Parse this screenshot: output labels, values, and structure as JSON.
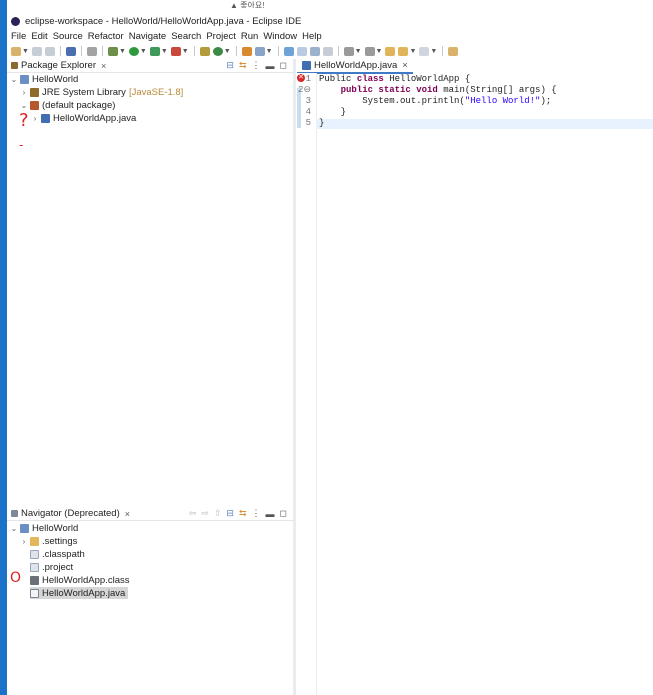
{
  "window": {
    "title": "eclipse-workspace - HelloWorld/HelloWorldApp.java - Eclipse IDE",
    "top_partial_text": "▲ 좋아요!"
  },
  "menu": [
    "File",
    "Edit",
    "Source",
    "Refactor",
    "Navigate",
    "Search",
    "Project",
    "Run",
    "Window",
    "Help"
  ],
  "colors": {
    "accent_strip": "#1a73c9",
    "keyword": "#7f0055",
    "string": "#2a00ff",
    "annotation": "#e02020"
  },
  "package_explorer": {
    "title": "Package Explorer",
    "close": "×",
    "items": [
      {
        "label": "HelloWorld",
        "twisty": "⌄",
        "icon": "project-icon"
      },
      {
        "label": "JRE System Library",
        "decoration": "[JavaSE-1.8]",
        "twisty": "›",
        "icon": "library-icon"
      },
      {
        "label": "(default package)",
        "twisty": "⌄",
        "icon": "package-icon"
      },
      {
        "label": "HelloWorldApp.java",
        "twisty": "›",
        "icon": "java-file-icon"
      }
    ]
  },
  "navigator": {
    "title": "Navigator (Deprecated)",
    "close": "×",
    "items": [
      {
        "label": "HelloWorld",
        "twisty": "⌄",
        "icon": "project-icon"
      },
      {
        "label": ".settings",
        "twisty": "›",
        "icon": "folder-icon"
      },
      {
        "label": ".classpath",
        "twisty": "",
        "icon": "file-icon"
      },
      {
        "label": ".project",
        "twisty": "",
        "icon": "file-icon"
      },
      {
        "label": "HelloWorldApp.class",
        "twisty": "",
        "icon": "class-file-icon"
      },
      {
        "label": "HelloWorldApp.java",
        "twisty": "",
        "icon": "java-file-icon"
      }
    ]
  },
  "editor": {
    "tab": "HelloWorldApp.java",
    "close": "×",
    "lines": [
      {
        "n": "1",
        "parts": [
          [
            "Public",
            "plain"
          ],
          [
            " ",
            "plain"
          ],
          [
            "class",
            "kw"
          ],
          [
            " HelloWorldApp {",
            "plain"
          ]
        ]
      },
      {
        "n": "2⊖",
        "parts": [
          [
            "    ",
            "plain"
          ],
          [
            "public",
            "kw"
          ],
          [
            " ",
            "plain"
          ],
          [
            "static",
            "kw"
          ],
          [
            " ",
            "plain"
          ],
          [
            "void",
            "kw"
          ],
          [
            " main(String[] args) {",
            "plain"
          ]
        ]
      },
      {
        "n": "3",
        "parts": [
          [
            "        System.out.println(",
            "plain"
          ],
          [
            "\"Hello World!\"",
            "str"
          ],
          [
            ");",
            "plain"
          ]
        ]
      },
      {
        "n": "4",
        "parts": [
          [
            "    }",
            "plain"
          ]
        ]
      },
      {
        "n": "5",
        "parts": [
          [
            "}",
            "plain"
          ]
        ]
      }
    ]
  },
  "annotations": {
    "question": "?",
    "dash": "-",
    "circle": "O"
  }
}
